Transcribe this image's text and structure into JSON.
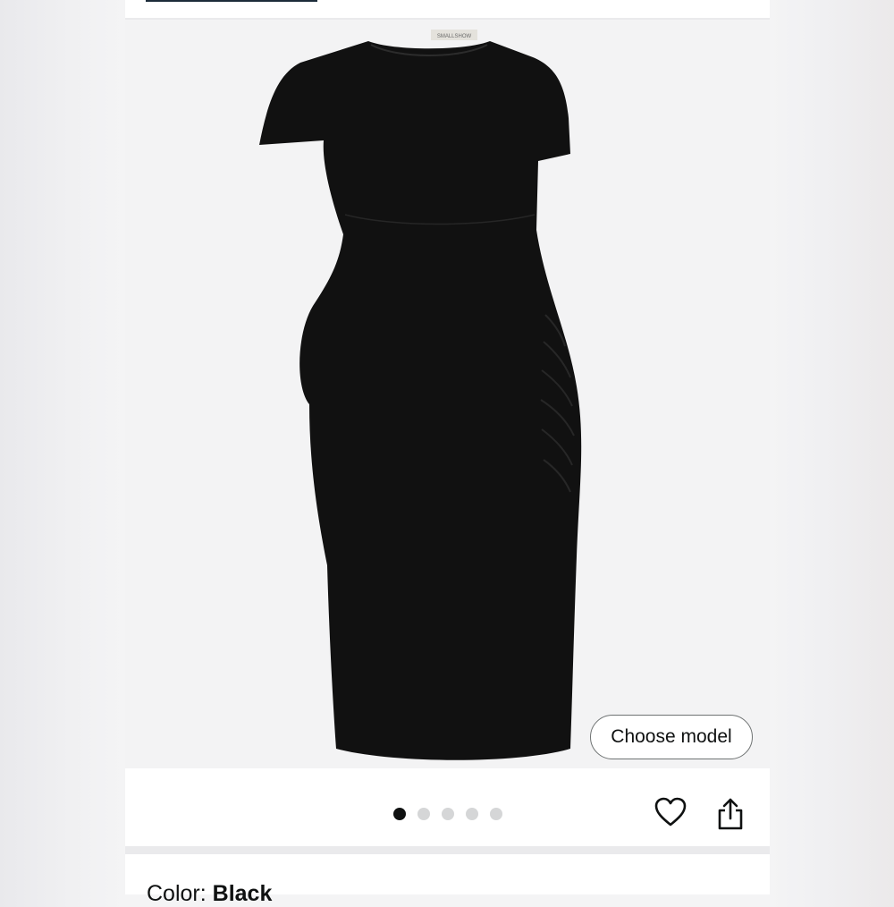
{
  "gallery": {
    "choose_model_label": "Choose model",
    "image_count": 5,
    "active_image_index": 1,
    "brand_tag": "SMALLSHOW"
  },
  "product": {
    "color_label": "Color:",
    "color_value": "Black"
  },
  "icons": {
    "favorite": "heart-icon",
    "share": "share-icon"
  },
  "colors": {
    "dress": "#111111",
    "active_dot": "#0f1111",
    "inactive_dot": "#d5d6d7"
  }
}
